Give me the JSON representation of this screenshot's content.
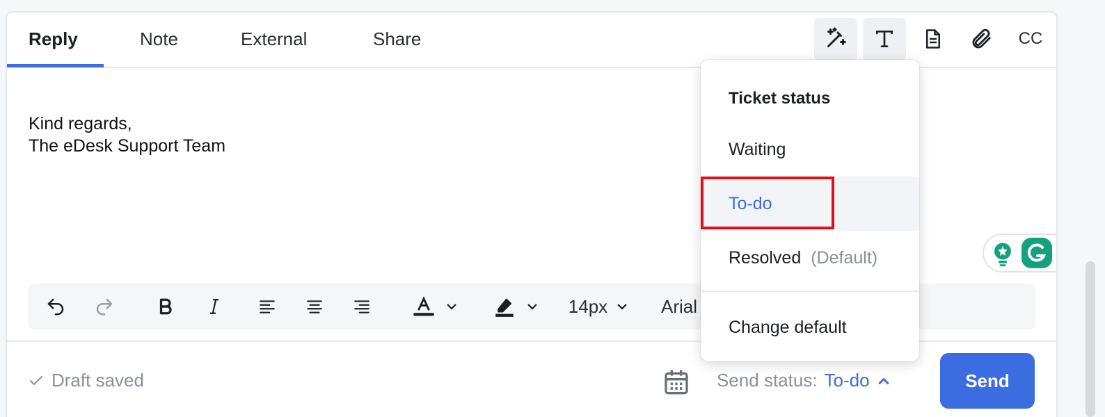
{
  "tabs": [
    {
      "label": "Reply",
      "active": true
    },
    {
      "label": "Note",
      "active": false
    },
    {
      "label": "External",
      "active": false
    },
    {
      "label": "Share",
      "active": false
    }
  ],
  "top_tools": {
    "ai": "magic-wand-icon",
    "text": "text-format-icon",
    "template": "document-icon",
    "attach": "paperclip-icon",
    "cc_label": "CC"
  },
  "body": {
    "line1": "Kind regards,",
    "line2": "The eDesk Support Team"
  },
  "format_toolbar": {
    "font_size": "14px",
    "font_family": "Arial"
  },
  "footer": {
    "draft_label": "Draft saved",
    "send_status_label": "Send status:",
    "send_status_value": "To-do",
    "send_label": "Send"
  },
  "dropdown": {
    "heading": "Ticket status",
    "items": [
      {
        "label": "Waiting",
        "note": ""
      },
      {
        "label": "To-do",
        "note": ""
      },
      {
        "label": "Resolved",
        "note": "(Default)"
      }
    ],
    "change_default": "Change default"
  },
  "colors": {
    "accent": "#3b6de0",
    "highlight": "#e00f1c",
    "grammarly": "#15a180"
  }
}
